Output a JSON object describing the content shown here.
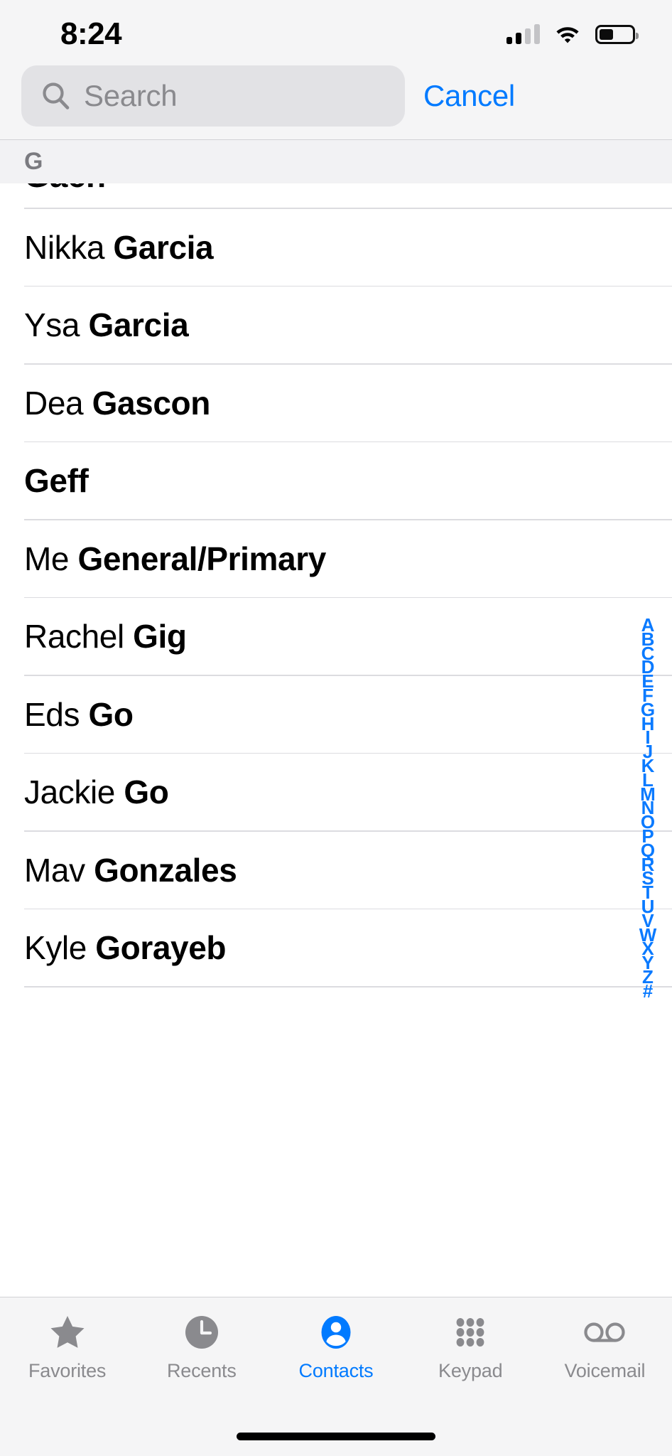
{
  "status_bar": {
    "time": "8:24",
    "cellular_icon": "cellular-signal-icon",
    "cellular_bars_filled": 2,
    "cellular_bars_total": 4,
    "wifi_icon": "wifi-icon",
    "battery_icon": "battery-icon",
    "battery_level_percent": 38
  },
  "search": {
    "placeholder": "Search",
    "value": "",
    "icon": "search-icon",
    "cancel_label": "Cancel"
  },
  "section": {
    "header_letter": "G"
  },
  "list": {
    "clipped_top_row": "Gach",
    "contacts": [
      {
        "first": "Nikka ",
        "last": "Garcia"
      },
      {
        "first": "Ysa ",
        "last": "Garcia"
      },
      {
        "first": "Dea ",
        "last": "Gascon"
      },
      {
        "first": "",
        "last": "Geff"
      },
      {
        "first": "Me ",
        "last": "General/Primary"
      },
      {
        "first": "Rachel ",
        "last": "Gig"
      },
      {
        "first": "Eds ",
        "last": "Go"
      },
      {
        "first": "Jackie ",
        "last": "Go"
      },
      {
        "first": "Mav ",
        "last": "Gonzales"
      },
      {
        "first": "Kyle ",
        "last": "Gorayeb"
      }
    ]
  },
  "alphabet_index": {
    "letters": [
      "A",
      "B",
      "C",
      "D",
      "E",
      "F",
      "G",
      "H",
      "I",
      "J",
      "K",
      "L",
      "M",
      "N",
      "O",
      "P",
      "Q",
      "R",
      "S",
      "T",
      "U",
      "V",
      "W",
      "X",
      "Y",
      "Z",
      "#"
    ],
    "color": "#0a7aff"
  },
  "tab_bar": {
    "active_index": 2,
    "accent_color": "#007aff",
    "inactive_color": "#8a8a8e",
    "tabs": [
      {
        "label": "Favorites",
        "icon": "star-icon"
      },
      {
        "label": "Recents",
        "icon": "clock-icon"
      },
      {
        "label": "Contacts",
        "icon": "person-circle-icon"
      },
      {
        "label": "Keypad",
        "icon": "keypad-dots-icon"
      },
      {
        "label": "Voicemail",
        "icon": "voicemail-icon"
      }
    ]
  },
  "home_indicator": "home-indicator-bar"
}
